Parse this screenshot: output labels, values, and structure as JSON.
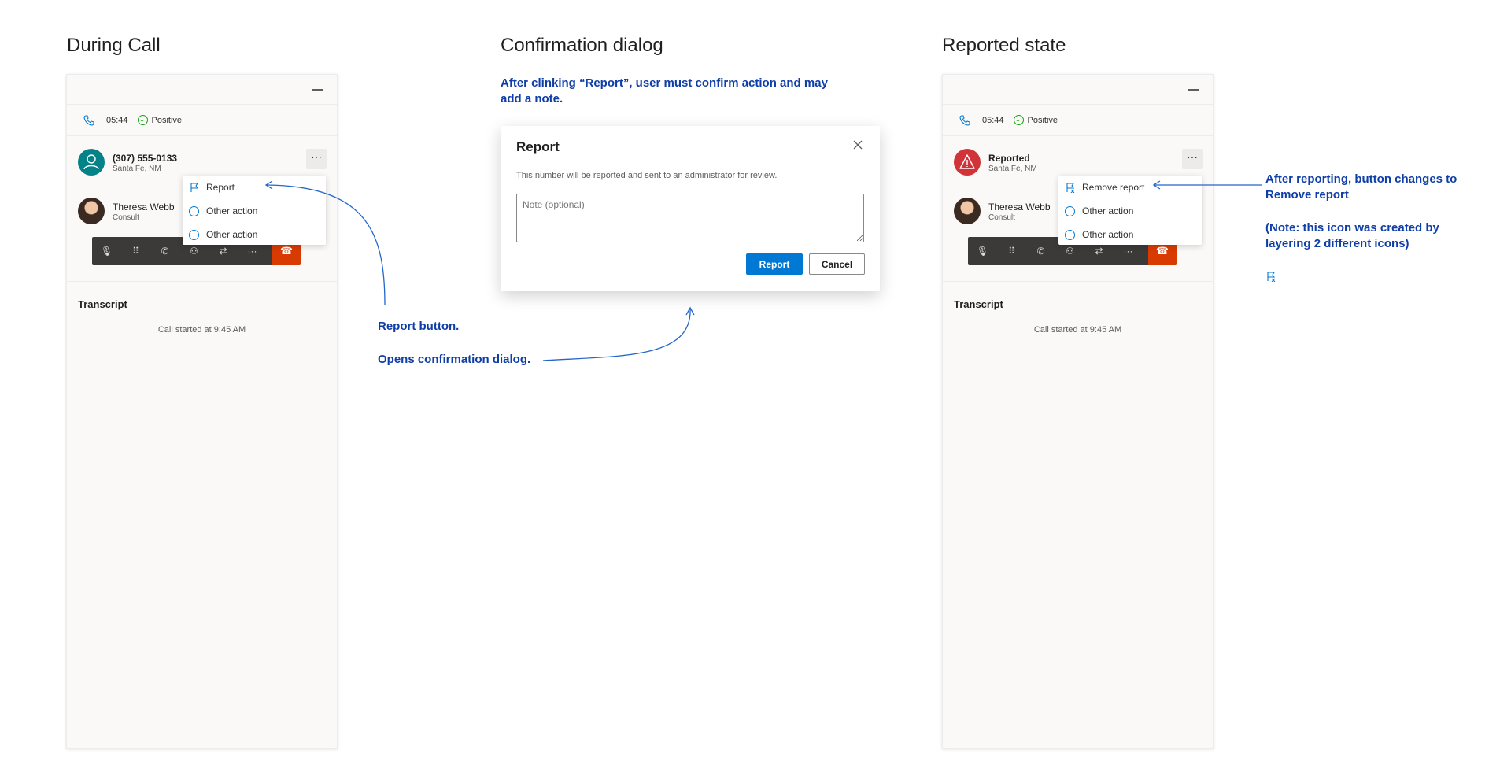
{
  "sections": {
    "during_call": "During Call",
    "confirmation": "Confirmation dialog",
    "reported": "Reported state"
  },
  "panel_common": {
    "timer": "05:44",
    "sentiment": "Positive",
    "consult_name": "Theresa Webb",
    "consult_role": "Consult",
    "more": "···",
    "transcript_title": "Transcript",
    "transcript_note": "Call started at 9:45 AM",
    "toolbar_icons": [
      "microphone-icon",
      "dialpad-icon",
      "hold-icon",
      "add-person-icon",
      "transfer-icon",
      "more-icon"
    ],
    "hangup_icon": "hangup-icon"
  },
  "during_call": {
    "caller_number": "(307) 555-0133",
    "caller_location": "Santa Fe, NM",
    "menu": {
      "report": "Report",
      "other1": "Other action",
      "other2": "Other action"
    }
  },
  "reported": {
    "caller_status": "Reported",
    "caller_location": "Santa Fe, NM",
    "menu": {
      "remove_report": "Remove report",
      "other1": "Other action",
      "other2": "Other action"
    }
  },
  "dialog": {
    "title": "Report",
    "message": "This number will be reported and sent to an administrator for review.",
    "note_placeholder": "Note (optional)",
    "confirm_label": "Report",
    "cancel_label": "Cancel"
  },
  "annotations": {
    "confirm_intro": "After clinking “Report”, user must confirm action and may add a note.",
    "report_button": "Report button.",
    "opens_dialog": "Opens confirmation dialog.",
    "after_reporting": "After reporting, button changes to Remove report",
    "icon_note": "(Note: this icon was created by layering 2 different icons)"
  },
  "colors": {
    "annotation": "#0f3ea8",
    "primary": "#0078d4",
    "hangup": "#d83b01",
    "reported_avatar": "#d13438",
    "caller_avatar": "#038387",
    "positive": "#13a10e"
  }
}
